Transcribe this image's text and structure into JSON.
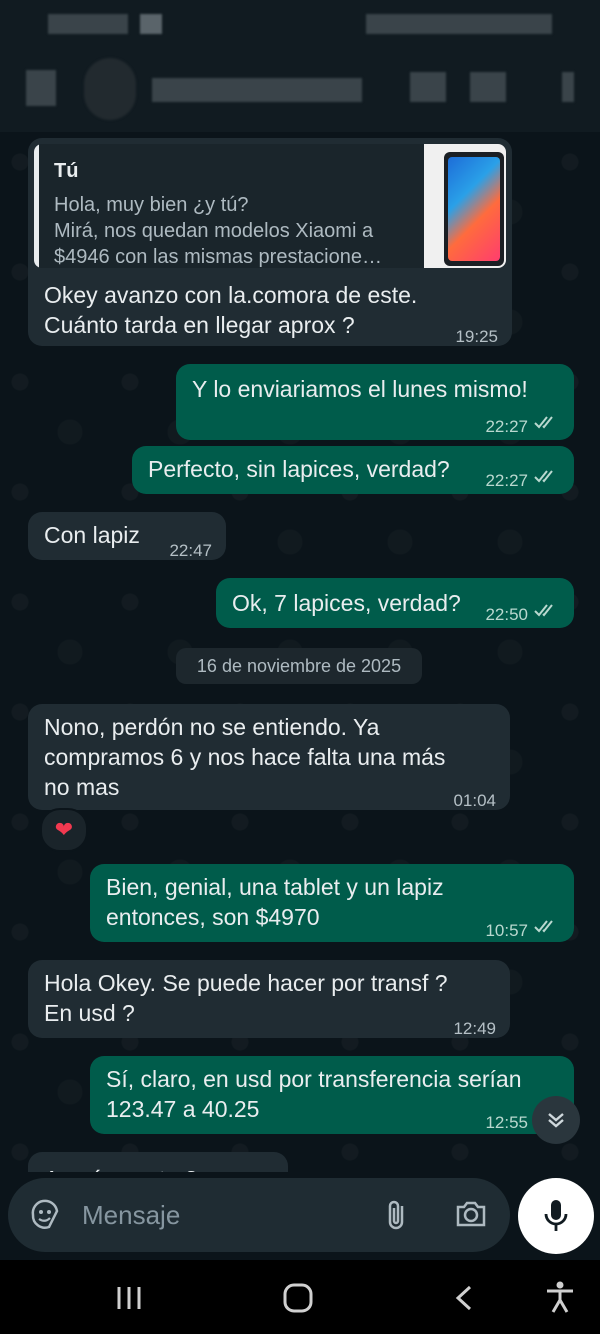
{
  "chat": {
    "reply": {
      "author": "Tú",
      "quoted_lines": [
        "Hola, muy bien ¿y tú?",
        "Mirá, nos quedan modelos Xiaomi a",
        "$4946 con las mismas prestacione…"
      ]
    },
    "messages": [
      {
        "dir": "in",
        "lines": [
          "Okey avanzo con la.comora de este.",
          "Cuánto tarda en llegar aprox ?"
        ],
        "time": "19:25"
      },
      {
        "dir": "out",
        "lines": [
          "Y lo enviariamos el lunes mismo!"
        ],
        "time": "22:27"
      },
      {
        "dir": "out",
        "lines": [
          "Perfecto, sin lapices, verdad?"
        ],
        "time": "22:27"
      },
      {
        "dir": "in",
        "lines": [
          "Con lapiz"
        ],
        "time": "22:47"
      },
      {
        "dir": "out",
        "lines": [
          "Ok, 7 lapices, verdad?"
        ],
        "time": "22:50"
      },
      {
        "dir": "in",
        "lines": [
          "Nono, perdón no se entiendo. Ya",
          "compramos 6 y nos hace falta una más",
          "no mas"
        ],
        "time": "01:04"
      },
      {
        "dir": "out",
        "lines": [
          "Bien, genial, una tablet y un lapiz",
          "entonces, son $4970"
        ],
        "time": "10:57"
      },
      {
        "dir": "in",
        "lines": [
          "Hola Okey. Se puede hacer por transf ?",
          "En usd ?"
        ],
        "time": "12:49"
      },
      {
        "dir": "out",
        "lines": [
          "Sí, claro, en usd por transferencia serían",
          "123.47 a 40.25"
        ],
        "time": "12:55"
      },
      {
        "dir": "in",
        "lines": [
          "A qué cuenta ?"
        ],
        "time": ""
      }
    ],
    "date_separator": "16 de noviembre de 2025",
    "reaction": "❤"
  },
  "input": {
    "placeholder": "Mensaje",
    "icons": [
      "sticker-icon",
      "attach-icon",
      "camera-icon",
      "mic-icon"
    ]
  },
  "nav": {
    "icons": [
      "recent-apps-icon",
      "home-icon",
      "back-icon",
      "accessibility-icon"
    ]
  },
  "colors": {
    "background": "#0b141a",
    "incoming": "#202c33",
    "outgoing": "#005c4b",
    "read_ticks": "#b9d8cf"
  }
}
